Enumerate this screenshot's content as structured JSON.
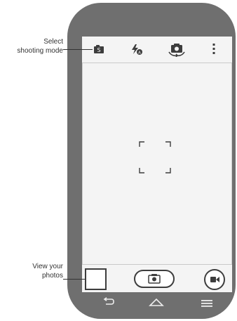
{
  "callouts": {
    "select_mode": "Select\nshooting mode",
    "view_photos": "View your\nphotos"
  },
  "top_bar": {
    "mode_icon": "mode-icon",
    "mode_icon_letter": "S",
    "flash_icon": "flash-icon",
    "switch_camera_icon": "switch-camera-icon",
    "overflow_icon": "overflow-icon"
  },
  "bottom_bar": {
    "thumbnail": "thumbnail",
    "shutter_icon": "camera-icon",
    "video_icon": "video-icon"
  },
  "nav_bar": {
    "back_icon": "back-icon",
    "home_icon": "home-icon",
    "menu_icon": "menu-icon"
  },
  "colors": {
    "phone": "#6f6f6f",
    "screen": "#f4f4f4",
    "icon": "#3d3d3d",
    "nav_icon": "#ededed"
  }
}
